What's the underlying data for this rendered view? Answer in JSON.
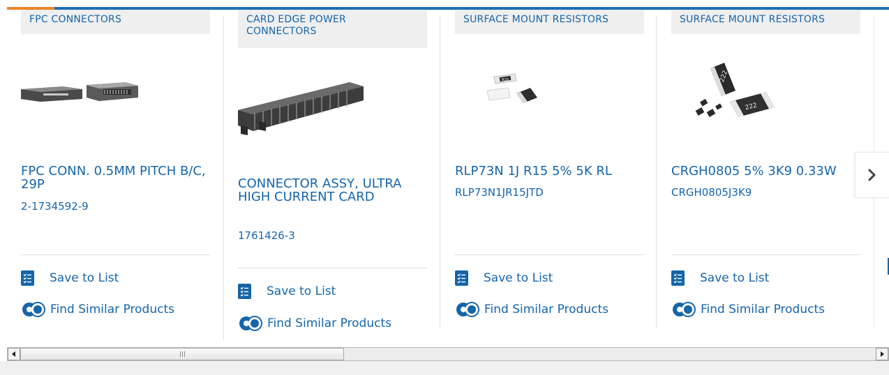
{
  "carousel": {
    "cards": [
      {
        "category": "FPC CONNECTORS",
        "image_alt": "fpc-connector-image",
        "title": "FPC CONN. 0.5MM PITCH B/C, 29P",
        "part_number": "2-1734592-9",
        "save_label": "Save to List",
        "similar_label": "Find Similar Products"
      },
      {
        "category": "CARD EDGE POWER CONNECTORS",
        "image_alt": "card-edge-connector-image",
        "title": "CONNECTOR ASSY, ULTRA HIGH CURRENT CARD",
        "part_number": "1761426-3",
        "save_label": "Save to List",
        "similar_label": "Find Similar Products"
      },
      {
        "category": "SURFACE MOUNT RESISTORS",
        "image_alt": "smd-resistor-image",
        "title": "RLP73N 1J R15 5% 5K RL",
        "part_number": "RLP73N1JR15JTD",
        "save_label": "Save to List",
        "similar_label": "Find Similar Products"
      },
      {
        "category": "SURFACE MOUNT RESISTORS",
        "image_alt": "smd-resistor-image",
        "title": "CRGH0805 5% 3K9 0.33W",
        "part_number": "CRGH0805J3K9",
        "save_label": "Save to List",
        "similar_label": "Find Similar Products"
      }
    ],
    "next_icon": "chevron-right-icon",
    "resistor_marking_1": "222",
    "resistor_marking_2": "222",
    "resistor_marking_3": "R10"
  },
  "colors": {
    "accent": "#1f6fb2",
    "accent_orange": "#e8862a",
    "link": "#1565a8"
  }
}
